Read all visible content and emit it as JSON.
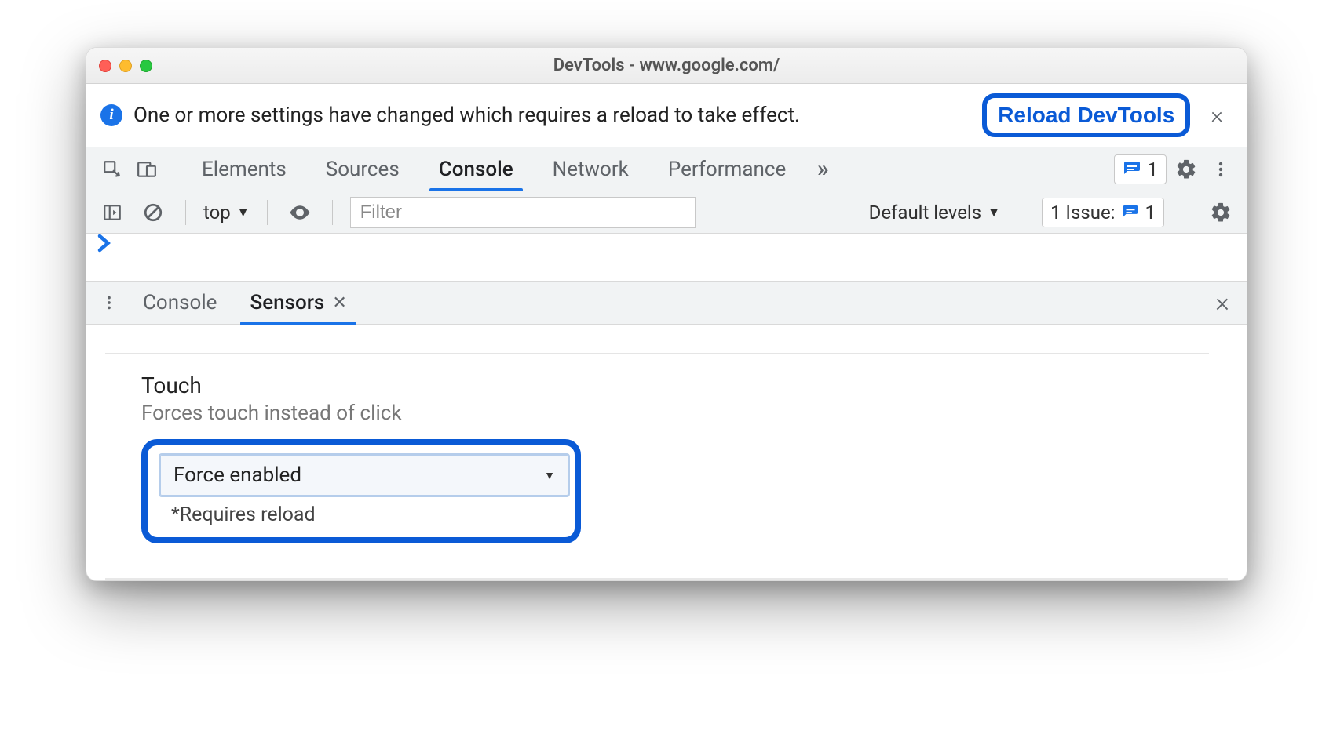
{
  "titlebar": {
    "title": "DevTools - www.google.com/"
  },
  "infobar": {
    "message": "One or more settings have changed which requires a reload to take effect.",
    "button": "Reload DevTools"
  },
  "tabs": {
    "items": [
      "Elements",
      "Sources",
      "Console",
      "Network",
      "Performance"
    ],
    "active": "Console",
    "issue_count": "1"
  },
  "console_toolbar": {
    "context": "top",
    "filter_placeholder": "Filter",
    "levels": "Default levels",
    "issues_label": "1 Issue:",
    "issues_count": "1"
  },
  "drawer": {
    "tabs": [
      "Console",
      "Sensors"
    ],
    "active": "Sensors"
  },
  "sensors": {
    "title": "Touch",
    "subtitle": "Forces touch instead of click",
    "select_value": "Force enabled",
    "note": "*Requires reload"
  }
}
